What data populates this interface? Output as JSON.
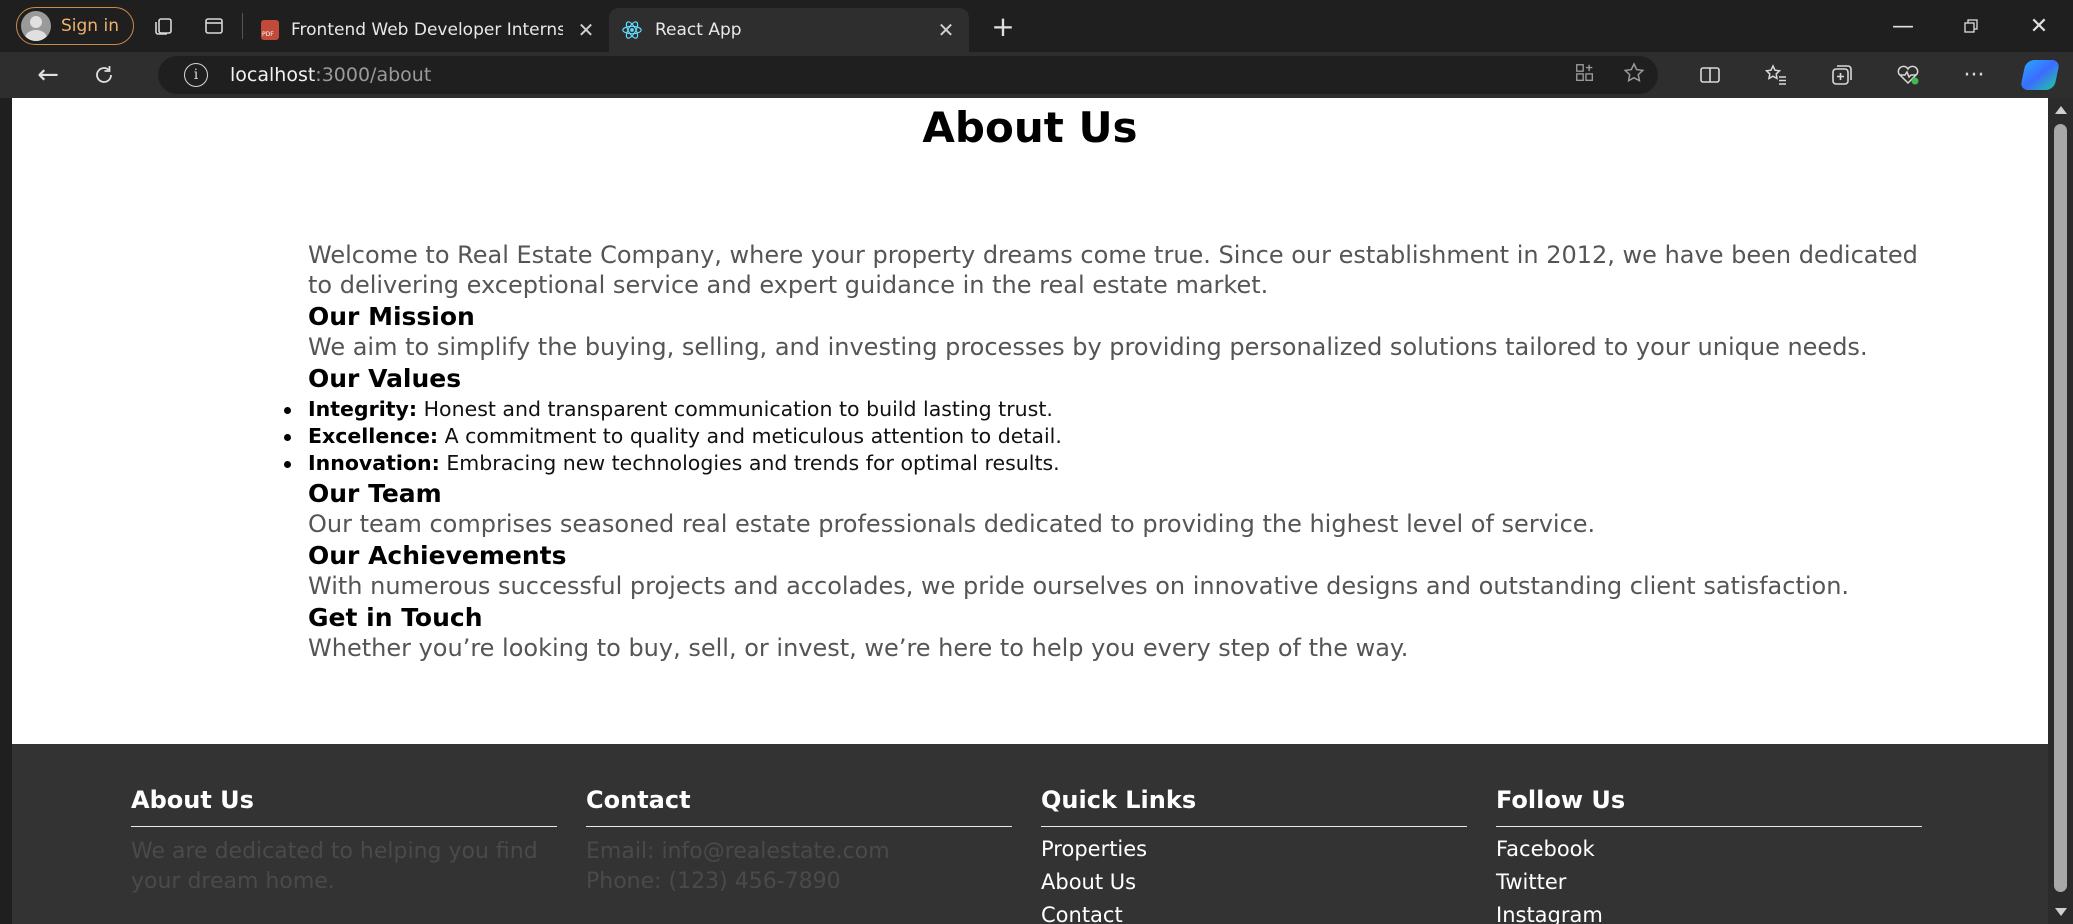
{
  "browser": {
    "profile_label": "Sign in",
    "tabs": [
      {
        "title": "Frontend Web Developer Internsh",
        "active": false
      },
      {
        "title": "React App",
        "active": true
      }
    ],
    "url_host": "localhost",
    "url_path": ":3000/about"
  },
  "page": {
    "title": "About Us",
    "intro": "Welcome to Real Estate Company, where your property dreams come true. Since our establishment in 2012, we have been dedicated to delivering exceptional service and expert guidance in the real estate market.",
    "mission_heading": "Our Mission",
    "mission_text": "We aim to simplify the buying, selling, and investing processes by providing personalized solutions tailored to your unique needs.",
    "values_heading": "Our Values",
    "values": [
      {
        "label": "Integrity:",
        "text": " Honest and transparent communication to build lasting trust."
      },
      {
        "label": "Excellence:",
        "text": " A commitment to quality and meticulous attention to detail."
      },
      {
        "label": "Innovation:",
        "text": " Embracing new technologies and trends for optimal results."
      }
    ],
    "team_heading": "Our Team",
    "team_text": "Our team comprises seasoned real estate professionals dedicated to providing the highest level of service.",
    "achievements_heading": "Our Achievements",
    "achievements_text": "With numerous successful projects and accolades, we pride ourselves on innovative designs and outstanding client satisfaction.",
    "contact_heading": "Get in Touch",
    "contact_text": "Whether you’re looking to buy, sell, or invest, we’re here to help you every step of the way."
  },
  "footer": {
    "about": {
      "heading": "About Us",
      "text": "We are dedicated to helping you find your dream home."
    },
    "contact": {
      "heading": "Contact",
      "email": "Email: info@realestate.com",
      "phone": "Phone: (123) 456-7890"
    },
    "quick_links": {
      "heading": "Quick Links",
      "links": [
        "Properties",
        "About Us",
        "Contact"
      ]
    },
    "follow": {
      "heading": "Follow Us",
      "links": [
        "Facebook",
        "Twitter",
        "Instagram"
      ]
    }
  }
}
